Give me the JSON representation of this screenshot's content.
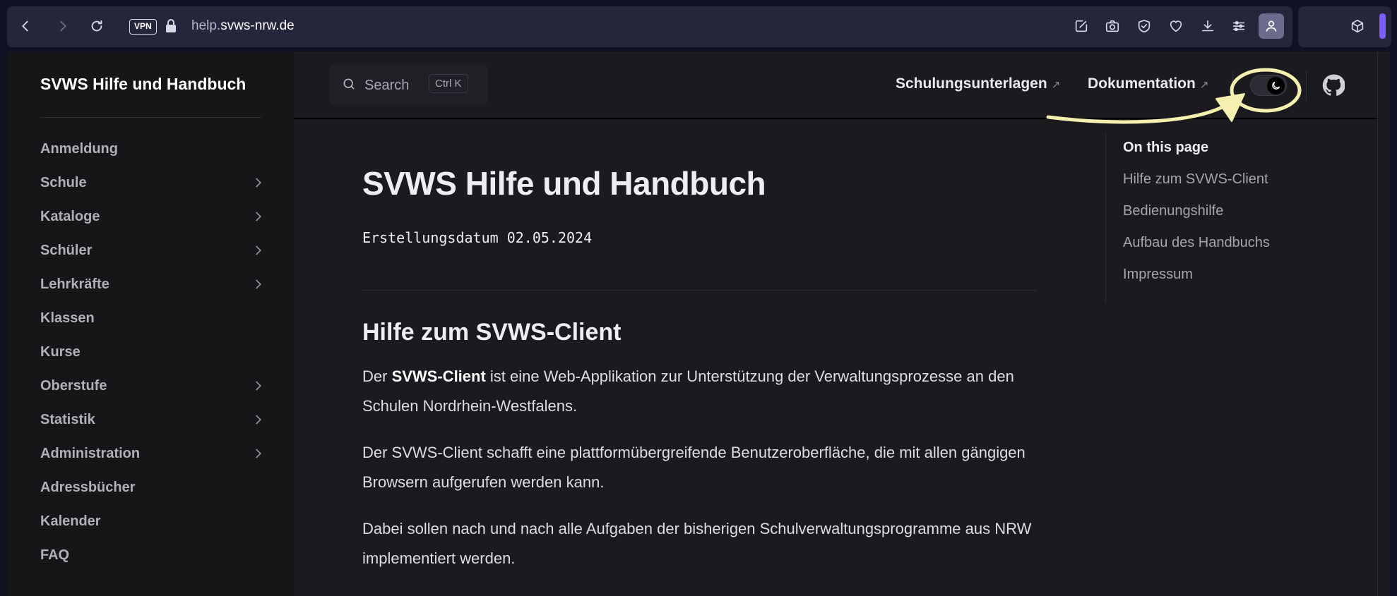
{
  "browser": {
    "vpn": "VPN",
    "url_sub": "help.",
    "url_main": "svws-nrw.de",
    "icons": [
      "back-icon",
      "forward-icon",
      "reload-icon",
      "lock-icon",
      "edit-icon",
      "camera-icon",
      "shield-icon",
      "heart-icon",
      "download-icon",
      "sliders-icon",
      "profile-icon",
      "cube-icon"
    ]
  },
  "sidebar": {
    "title": "SVWS Hilfe und Handbuch",
    "items": [
      {
        "label": "Anmeldung",
        "expandable": false
      },
      {
        "label": "Schule",
        "expandable": true
      },
      {
        "label": "Kataloge",
        "expandable": true
      },
      {
        "label": "Schüler",
        "expandable": true
      },
      {
        "label": "Lehrkräfte",
        "expandable": true
      },
      {
        "label": "Klassen",
        "expandable": false
      },
      {
        "label": "Kurse",
        "expandable": false
      },
      {
        "label": "Oberstufe",
        "expandable": true
      },
      {
        "label": "Statistik",
        "expandable": true
      },
      {
        "label": "Administration",
        "expandable": true
      },
      {
        "label": "Adressbücher",
        "expandable": false
      },
      {
        "label": "Kalender",
        "expandable": false
      },
      {
        "label": "FAQ",
        "expandable": false
      }
    ]
  },
  "header": {
    "search_label": "Search",
    "search_shortcut": "Ctrl K",
    "link1": "Schulungsunterlagen",
    "link2": "Dokumentation",
    "ext_arrow": "↗"
  },
  "main": {
    "title": "SVWS Hilfe und Handbuch",
    "date": "Erstellungsdatum 02.05.2024",
    "section_title": "Hilfe zum SVWS-Client",
    "p1_pre": "Der ",
    "p1_bold": "SVWS-Client",
    "p1_post": " ist eine Web-Applikation zur Unterstützung der Verwaltungsprozesse an den Schulen Nordrhein-Westfalens.",
    "p2": "Der SVWS-Client schafft eine plattformübergreifende Benutzeroberfläche, die mit allen gängigen Browsern aufgerufen werden kann.",
    "p3": "Dabei sollen nach und nach alle Aufgaben der bisherigen Schulverwaltungsprogramme aus NRW implementiert werden."
  },
  "toc": {
    "title": "On this page",
    "items": [
      "Hilfe zum SVWS-Client",
      "Bedienungshilfe",
      "Aufbau des Handbuchs",
      "Impressum"
    ]
  },
  "colors": {
    "annotation": "#f5f0b0",
    "accent": "#7a5cff"
  }
}
